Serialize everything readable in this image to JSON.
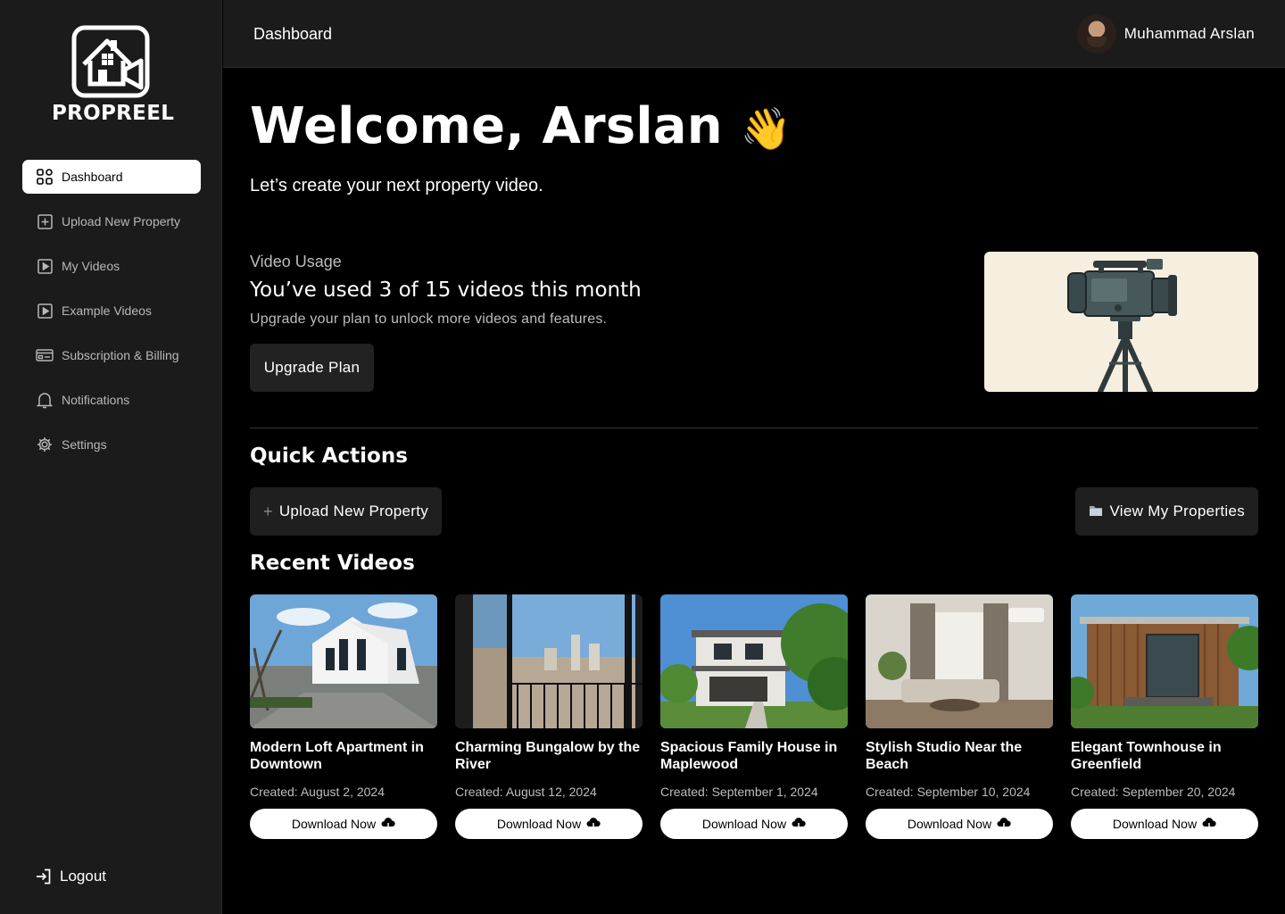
{
  "brand": {
    "name": "PROPREEL"
  },
  "sidebar": {
    "items": [
      {
        "label": "Dashboard",
        "icon": "dashboard-grid-icon",
        "active": true
      },
      {
        "label": "Upload New Property",
        "icon": "plus-square-icon"
      },
      {
        "label": "My Videos",
        "icon": "play-square-icon"
      },
      {
        "label": "Example Videos",
        "icon": "play-square-icon"
      },
      {
        "label": "Subscription & Billing",
        "icon": "credit-card-icon"
      },
      {
        "label": "Notifications",
        "icon": "bell-icon"
      },
      {
        "label": "Settings",
        "icon": "gear-icon"
      }
    ],
    "logout": "Logout"
  },
  "header": {
    "title": "Dashboard",
    "user_name": "Muhammad Arslan"
  },
  "welcome": {
    "heading": "Welcome, Arslan",
    "emoji": "👋",
    "subtitle": "Let’s create your next property video."
  },
  "usage": {
    "label": "Video Usage",
    "headline": "You’ve used 3 of 15 videos this month",
    "used": 3,
    "limit": 15,
    "description": "Upgrade your plan to unlock more videos and features.",
    "button": "Upgrade Plan"
  },
  "quick_actions": {
    "title": "Quick Actions",
    "upload": {
      "icon": "plus-icon",
      "label": "Upload New Property"
    },
    "view": {
      "icon": "folder-icon",
      "label": "View My Properties"
    }
  },
  "recent": {
    "title": "Recent Videos",
    "videos": [
      {
        "title": "Modern Loft Apartment in Downtown",
        "date": "Created: August 2, 2024",
        "button": "Download Now"
      },
      {
        "title": "Charming Bungalow by the River",
        "date": "Created: August 12, 2024",
        "button": "Download Now"
      },
      {
        "title": "Spacious Family House in Maplewood",
        "date": "Created: September 1, 2024",
        "button": "Download Now"
      },
      {
        "title": "Stylish Studio Near the Beach",
        "date": "Created: September 10, 2024",
        "button": "Download Now"
      },
      {
        "title": "Elegant Townhouse in Greenfield",
        "date": "Created: September 20, 2024",
        "button": "Download Now"
      }
    ]
  },
  "colors": {
    "sidebar_bg": "#1b1b1b",
    "main_bg": "#000000",
    "active_item_bg": "#ffffff",
    "camera_card_bg": "#f6efe0"
  }
}
